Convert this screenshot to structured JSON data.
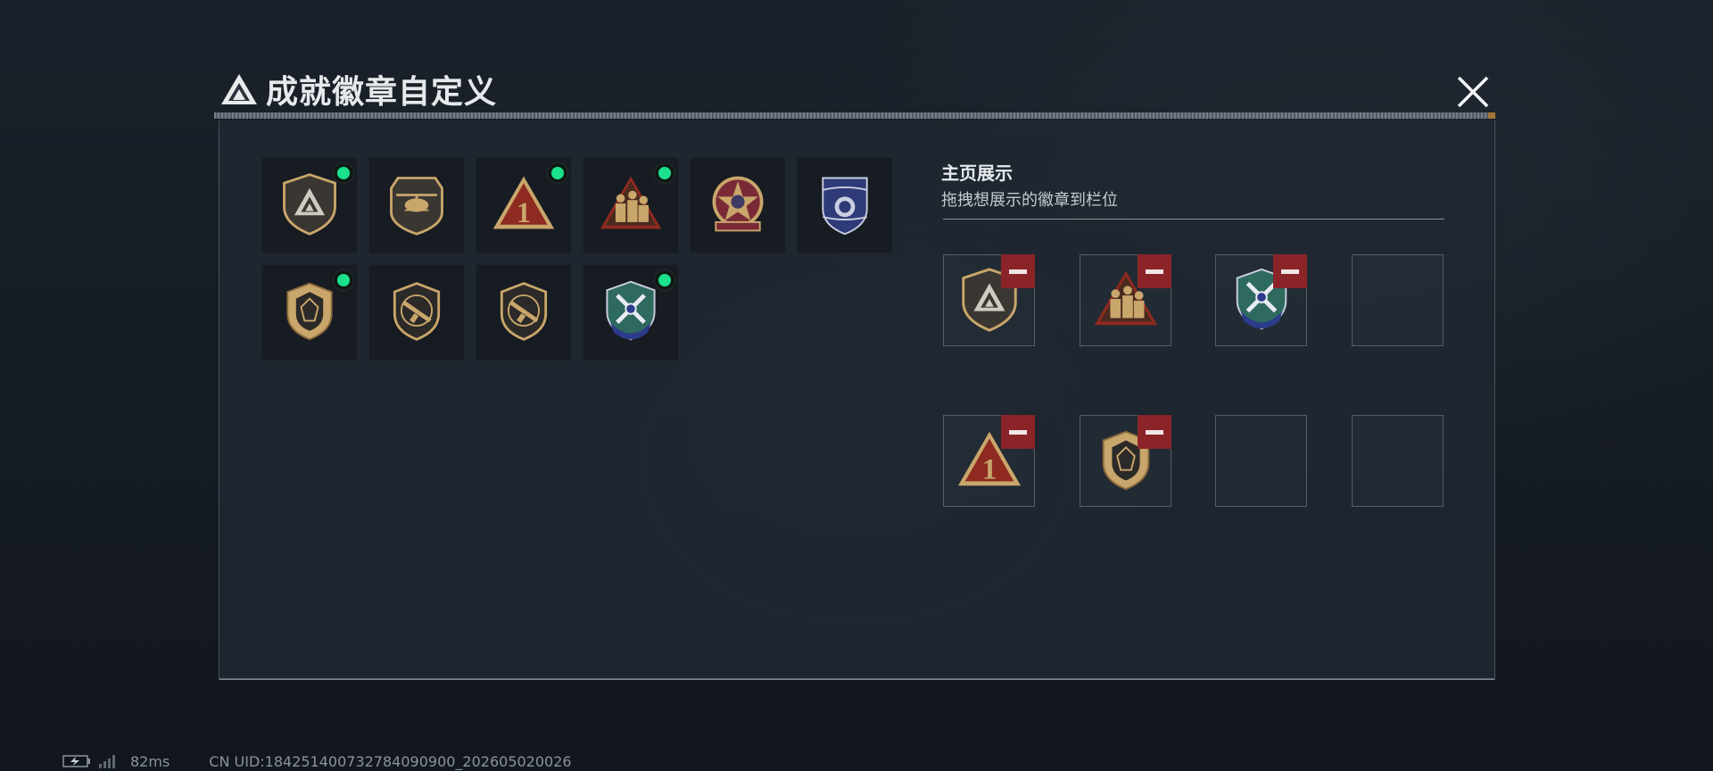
{
  "window": {
    "title": "成就徽章自定义",
    "close_icon": "close-x-icon"
  },
  "collection": {
    "badges": [
      {
        "icon": "triangle-shield-badge",
        "new": true
      },
      {
        "icon": "helicopter-badge",
        "new": false
      },
      {
        "icon": "number-one-triangle-badge",
        "new": true
      },
      {
        "icon": "soldiers-triangle-badge",
        "new": true
      },
      {
        "icon": "star-medal-badge",
        "new": false
      },
      {
        "icon": "blue-winged-shield-badge",
        "new": false
      },
      {
        "icon": "gem-shield-badge",
        "new": true
      },
      {
        "icon": "rifle-shield-badge",
        "new": false
      },
      {
        "icon": "smg-shield-badge",
        "new": false
      },
      {
        "icon": "blue-crossed-weapons-badge",
        "new": true
      }
    ]
  },
  "showcase": {
    "title": "主页展示",
    "subtitle": "拖拽想展示的徽章到栏位",
    "slots": [
      {
        "icon": "triangle-shield-badge",
        "filled": true
      },
      {
        "icon": "soldiers-triangle-badge",
        "filled": true
      },
      {
        "icon": "blue-crossed-weapons-badge",
        "filled": true
      },
      {
        "icon": "",
        "filled": false
      },
      {
        "icon": "number-one-triangle-badge",
        "filled": true
      },
      {
        "icon": "gem-shield-badge",
        "filled": true
      },
      {
        "icon": "",
        "filled": false
      },
      {
        "icon": "",
        "filled": false
      }
    ],
    "remove_icon": "minus-icon"
  },
  "footer": {
    "ping": "82ms",
    "uid": "CN UID:184251400732784090900_202605020026"
  },
  "colors": {
    "new_indicator": "#1be08c",
    "remove_button": "#8b2428",
    "panel_bg": "#202832"
  }
}
